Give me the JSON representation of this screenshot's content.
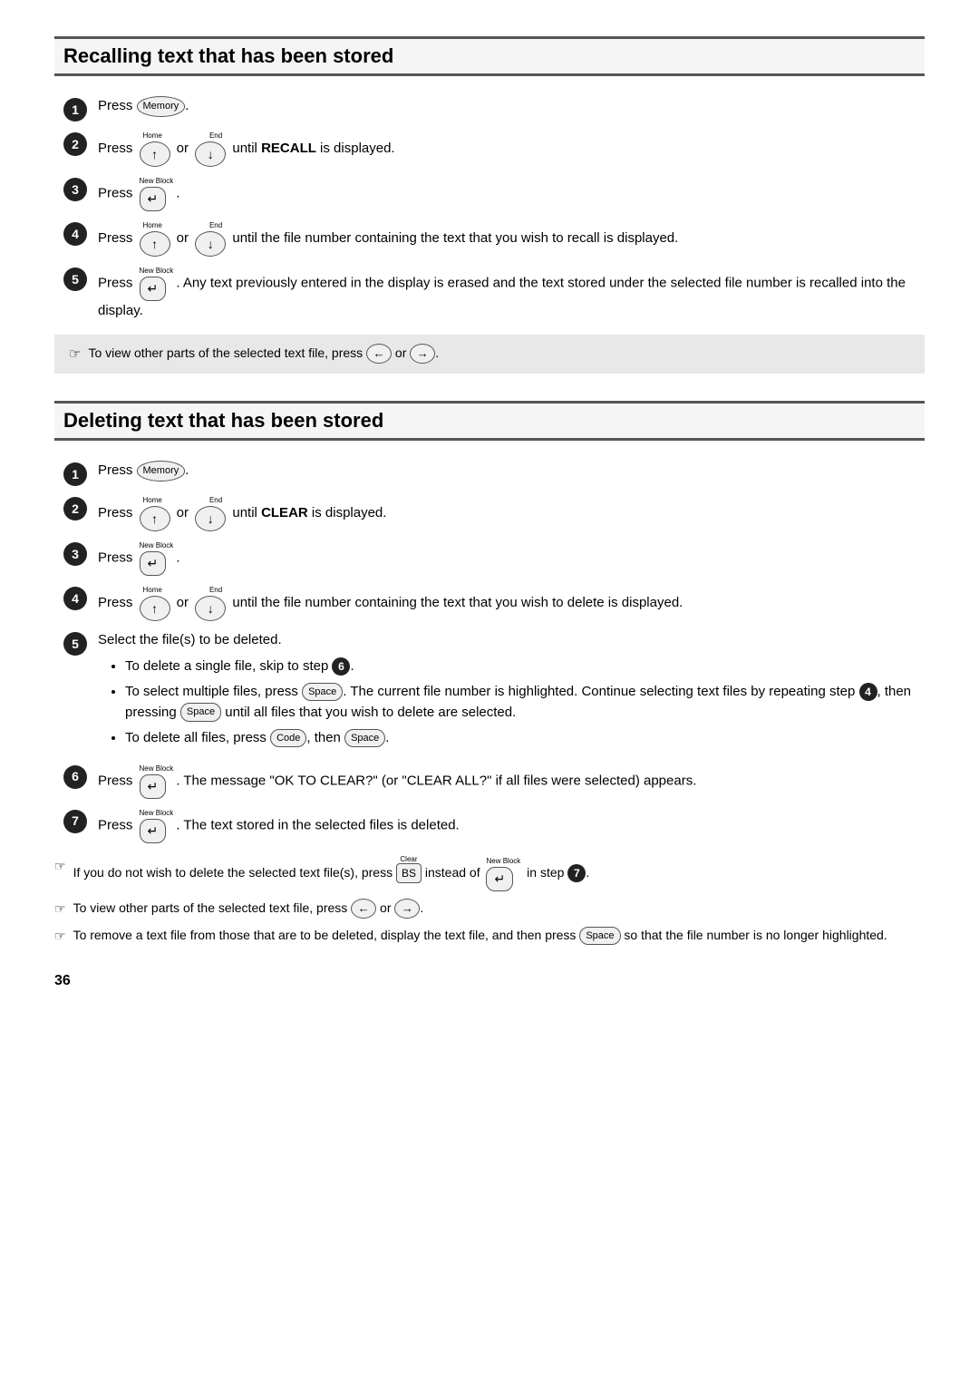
{
  "section1": {
    "title": "Recalling text that has been stored",
    "steps": [
      {
        "num": "1",
        "text_before": "Press",
        "key": "Memory",
        "text_after": "."
      },
      {
        "num": "2",
        "text_before": "Press",
        "arrow_home": "Home",
        "arrow_end": "End",
        "or": "or",
        "text_after": "until",
        "bold": "RECALL",
        "text_end": "is displayed."
      },
      {
        "num": "3",
        "text_before": "Press",
        "key_label": "New Block",
        "key_symbol": "↵",
        "text_after": "."
      },
      {
        "num": "4",
        "text_before": "Press",
        "or": "or",
        "text_after": "until the file number containing the text that you wish to recall is displayed."
      },
      {
        "num": "5",
        "text_before": "Press",
        "key_label": "New Block",
        "key_symbol": "↵",
        "text_after": ". Any text previously entered in the display is erased and the text stored under the selected file number is recalled into the display."
      }
    ],
    "note": "To view other parts of the selected text file, press ← or →."
  },
  "section2": {
    "title": "Deleting text that has been stored",
    "steps": [
      {
        "num": "1",
        "text_before": "Press",
        "key": "Memory",
        "text_after": "."
      },
      {
        "num": "2",
        "text_before": "Press",
        "or": "or",
        "text_after": "until",
        "bold": "CLEAR",
        "text_end": "is displayed."
      },
      {
        "num": "3",
        "text_before": "Press",
        "key_label": "New Block",
        "key_symbol": "↵",
        "text_after": "."
      },
      {
        "num": "4",
        "text_before": "Press",
        "or": "or",
        "text_after": "until the file number containing the text that you wish to delete is displayed."
      },
      {
        "num": "5",
        "text": "Select the file(s) to be deleted.",
        "bullets": [
          "To delete a single file, skip to step ❻.",
          "To select multiple files, press [Space]. The current file number is highlighted. Continue selecting text files by repeating step ❹, then pressing [Space] until all files that you wish to delete are selected.",
          "To delete all files, press [Code], then [Space]."
        ]
      },
      {
        "num": "6",
        "text_before": "Press",
        "key_label": "New Block",
        "key_symbol": "↵",
        "text_after": ". The message \"OK TO CLEAR?\" (or \"CLEAR ALL?\" if all files were selected) appears."
      },
      {
        "num": "7",
        "text_before": "Press",
        "key_label": "New Block",
        "key_symbol": "↵",
        "text_after": ". The text stored in the selected files is deleted."
      }
    ],
    "notes": [
      "If you do not wish to delete the selected text file(s), press [BS] instead of [↵] in step ❼.",
      "To view other parts of the selected text file, press ← or →.",
      "To remove a text file from those that are to be deleted, display the text file, and then press [Space] so that the file number is no longer highlighted."
    ]
  },
  "page_number": "36"
}
